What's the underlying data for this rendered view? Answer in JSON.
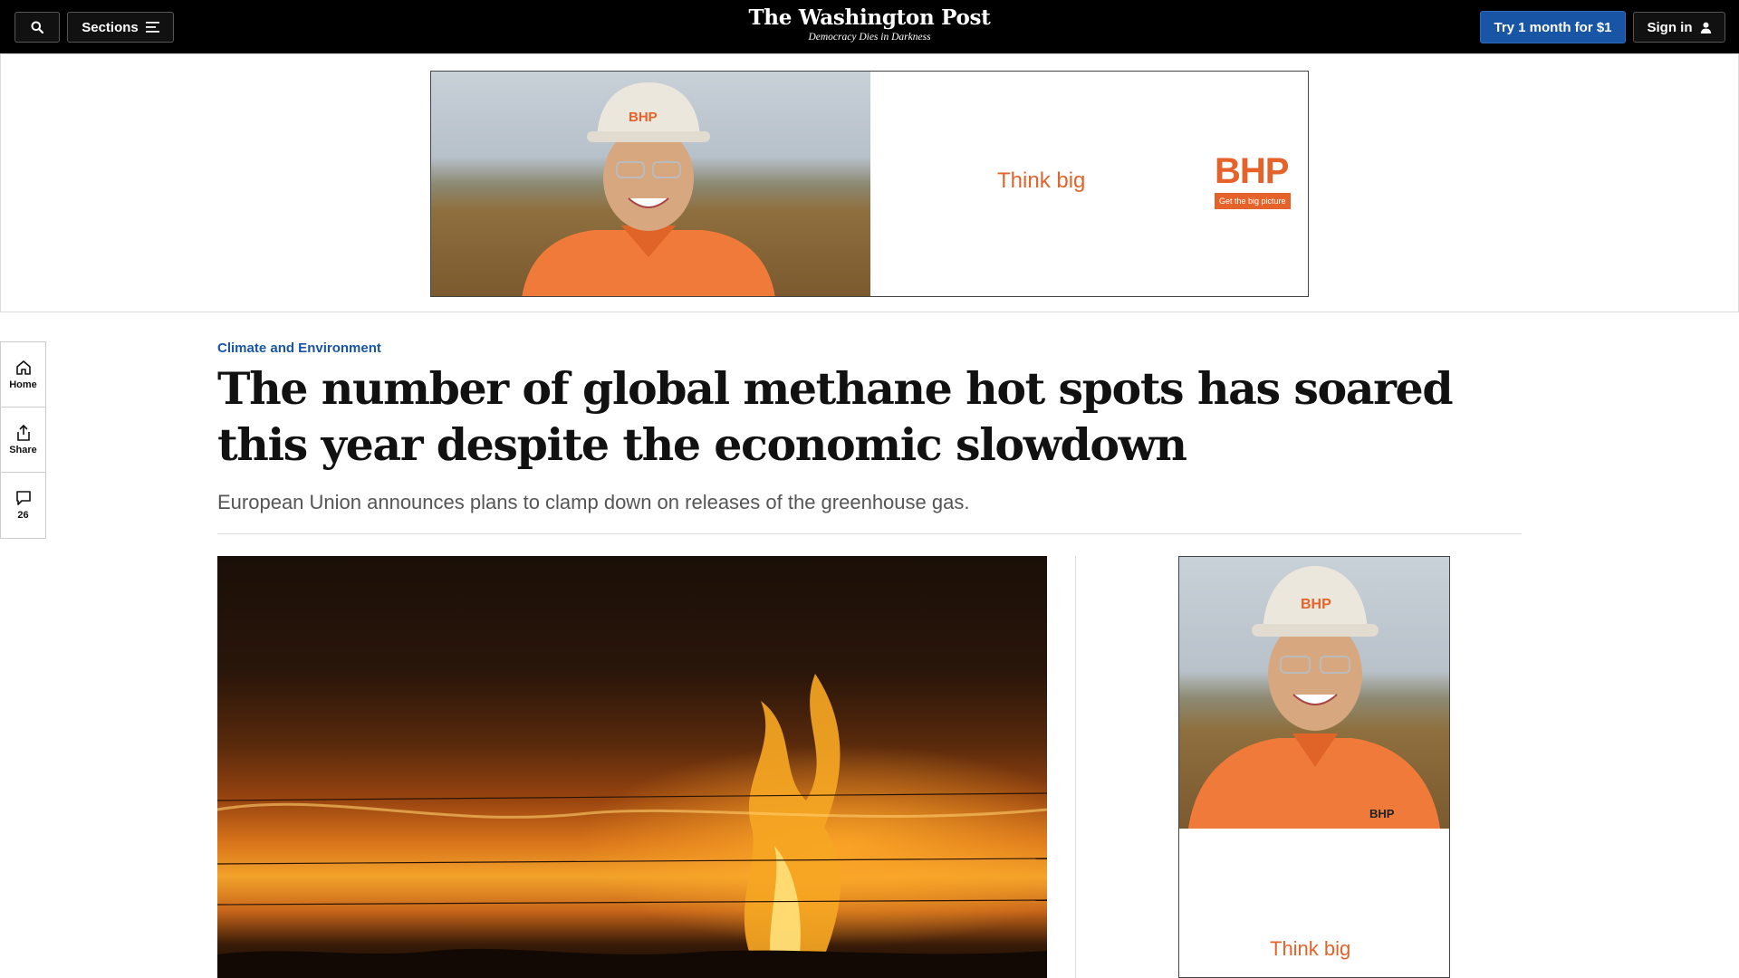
{
  "header": {
    "sections_label": "Sections",
    "logo_text": "The Washington Post",
    "tagline": "Democracy Dies in Darkness",
    "subscribe_label": "Try 1 month for $1",
    "signin_label": "Sign in"
  },
  "ads": {
    "top": {
      "slogan": "Think big",
      "brand": "BHP",
      "tag": "Get the big picture",
      "helmet_text": "BHP"
    },
    "side": {
      "slogan": "Think big",
      "helmet_text": "BHP",
      "shirt_logo": "BHP"
    }
  },
  "rail": {
    "home_label": "Home",
    "share_label": "Share",
    "comments_count": "26"
  },
  "article": {
    "kicker": "Climate and Environment",
    "headline": "The number of global methane hot spots has soared this year despite the economic slowdown",
    "dek": "European Union announces plans to clamp down on releases of the greenhouse gas."
  },
  "colors": {
    "topbar": "#000000",
    "subscribe_button": "#1955a5",
    "kicker": "#1955a5",
    "bhp_orange": "#e5632a"
  },
  "icons": [
    "search-icon",
    "menu-icon",
    "user-icon",
    "home-icon",
    "share-icon",
    "comment-icon"
  ]
}
